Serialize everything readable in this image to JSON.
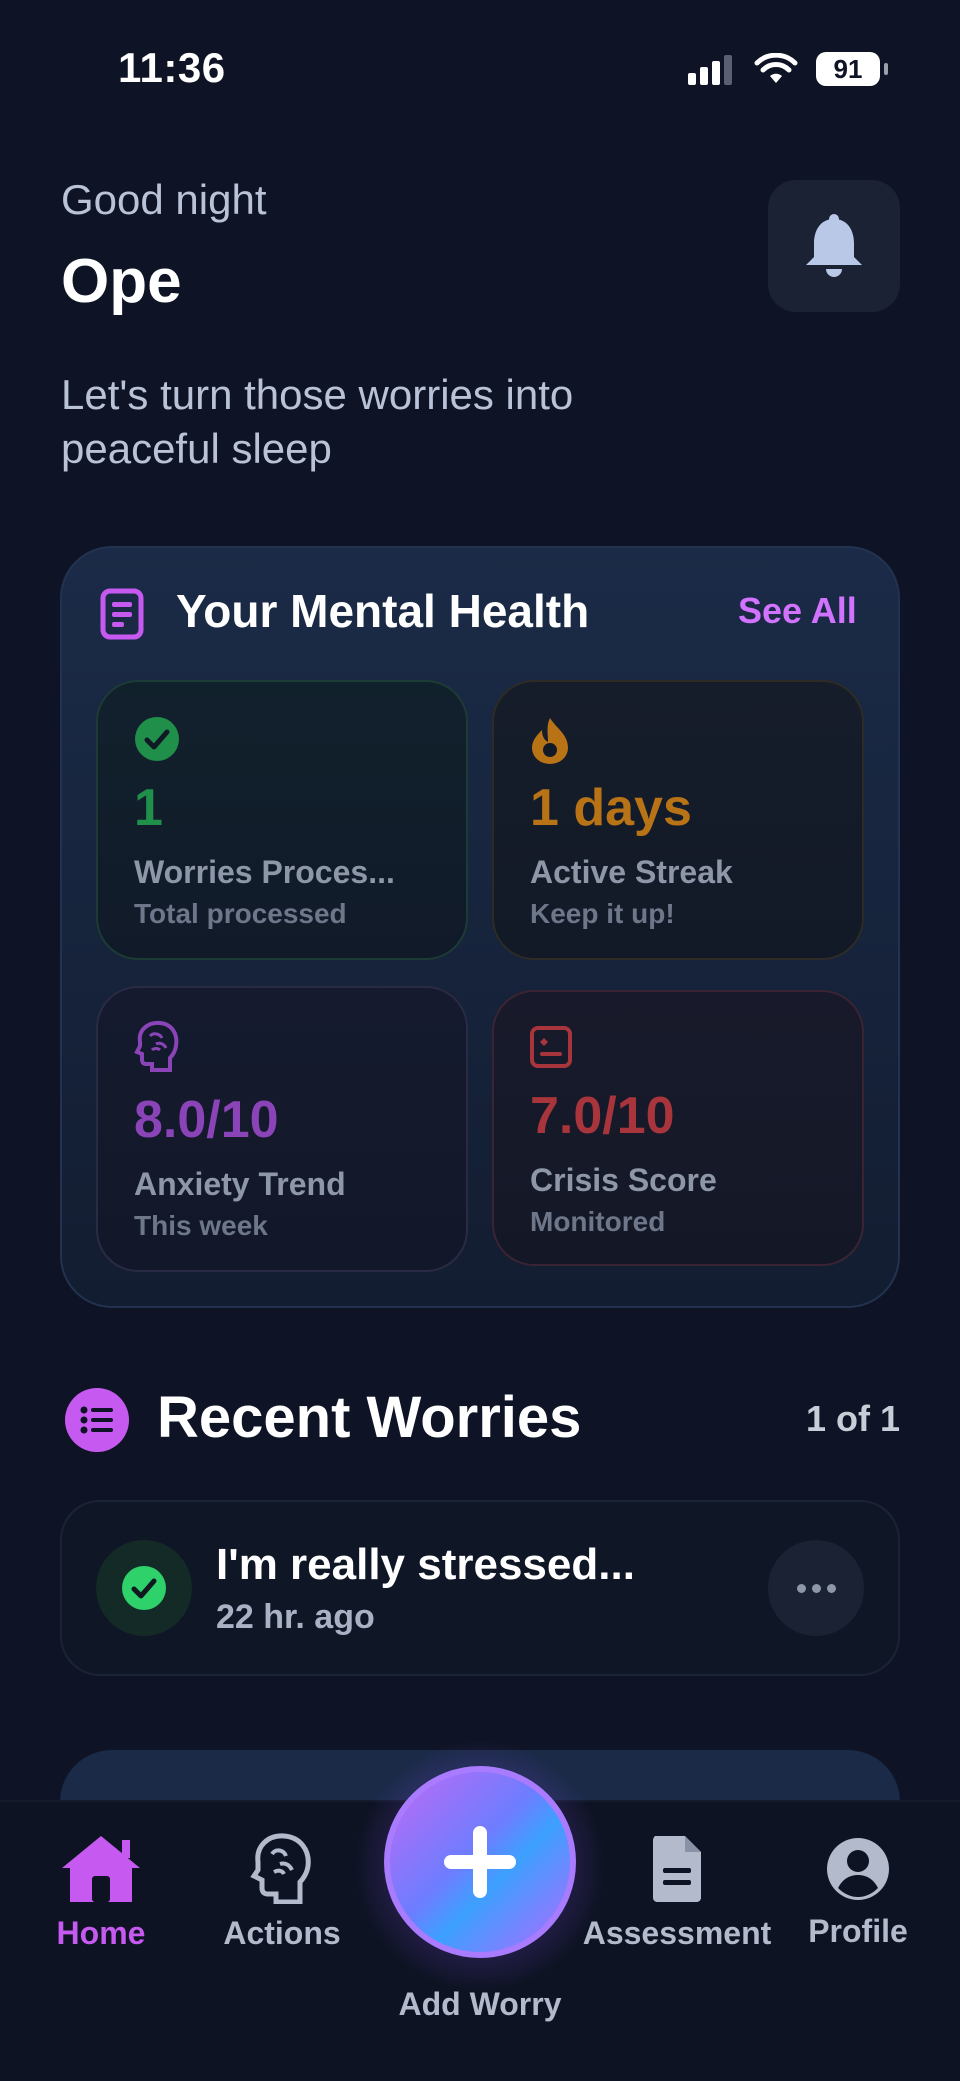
{
  "status_bar": {
    "time": "11:36",
    "battery": "91"
  },
  "header": {
    "greeting": "Good night",
    "name": "Ope",
    "subtitle": "Let's turn those worries into peaceful sleep"
  },
  "mental_health": {
    "title": "Your Mental Health",
    "see_all": "See All",
    "stats": [
      {
        "value": "1",
        "label": "Worries Proces...",
        "sub": "Total processed",
        "color": "#1f8f4a",
        "icon": "check-circle-icon"
      },
      {
        "value": "1 days",
        "label": "Active Streak",
        "sub": "Keep it up!",
        "color": "#b87316",
        "icon": "flame-icon"
      },
      {
        "value": "8.0/10",
        "label": "Anxiety Trend",
        "sub": "This week",
        "color": "#8a44b8",
        "icon": "brain-icon"
      },
      {
        "value": "7.0/10",
        "label": "Crisis Score",
        "sub": "Monitored",
        "color": "#a8343c",
        "icon": "report-icon"
      }
    ]
  },
  "recent_worries": {
    "title": "Recent Worries",
    "count": "1 of 1",
    "items": [
      {
        "text": "I'm really stressed...",
        "time": "22 hr. ago"
      }
    ]
  },
  "nav": {
    "home": "Home",
    "actions": "Actions",
    "add": "Add Worry",
    "assessment": "Assessment",
    "profile": "Profile",
    "active_color": "#c65af0"
  }
}
